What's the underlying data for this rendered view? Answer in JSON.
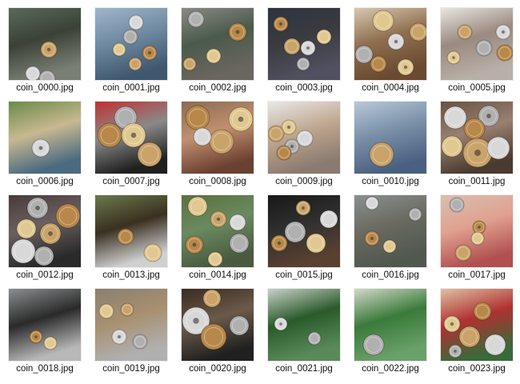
{
  "files": [
    {
      "name": "coin_0000.jpg",
      "bg": [
        "#5a6a5a",
        "#3b4136",
        "#7a7f74"
      ],
      "coins": [
        [
          50,
          52,
          10
        ],
        [
          30,
          82,
          9
        ],
        [
          48,
          88,
          10
        ]
      ]
    },
    {
      "name": "coin_0001.jpg",
      "bg": [
        "#9fb6cc",
        "#6f8aa1",
        "#3f5870"
      ],
      "coins": [
        [
          51,
          18,
          9
        ],
        [
          44,
          36,
          9
        ],
        [
          68,
          56,
          9
        ],
        [
          30,
          52,
          8
        ],
        [
          50,
          70,
          8
        ]
      ]
    },
    {
      "name": "coin_0002.jpg",
      "bg": [
        "#8a8a86",
        "#4a5a4a",
        "#6a6660"
      ],
      "coins": [
        [
          18,
          14,
          10
        ],
        [
          70,
          30,
          11
        ],
        [
          40,
          60,
          9
        ],
        [
          10,
          70,
          8
        ]
      ]
    },
    {
      "name": "coin_0003.jpg",
      "bg": [
        "#2e3440",
        "#3a3b3f",
        "#505060"
      ],
      "coins": [
        [
          16,
          20,
          9
        ],
        [
          70,
          36,
          9
        ],
        [
          30,
          48,
          10
        ],
        [
          50,
          50,
          9
        ],
        [
          44,
          70,
          8
        ]
      ]
    },
    {
      "name": "coin_0004.jpg",
      "bg": [
        "#d8c8b0",
        "#8f6f4f",
        "#6a4a30"
      ],
      "coins": [
        [
          36,
          16,
          13
        ],
        [
          80,
          30,
          11
        ],
        [
          52,
          42,
          10
        ],
        [
          12,
          58,
          11
        ],
        [
          30,
          70,
          10
        ],
        [
          64,
          74,
          10
        ]
      ]
    },
    {
      "name": "coin_0005.jpg",
      "bg": [
        "#e8e6e0",
        "#9a8a80",
        "#b8b0a8"
      ],
      "coins": [
        [
          30,
          30,
          9
        ],
        [
          78,
          30,
          9
        ],
        [
          54,
          50,
          10
        ],
        [
          80,
          56,
          10
        ],
        [
          16,
          62,
          8
        ]
      ]
    },
    {
      "name": "coin_0006.jpg",
      "bg": [
        "#6a8a4a",
        "#c8b890",
        "#4a6a80"
      ],
      "coins": [
        [
          40,
          58,
          11
        ]
      ]
    },
    {
      "name": "coin_0007.jpg",
      "bg": [
        "#c03030",
        "#8a8a8a",
        "#202020"
      ],
      "coins": [
        [
          38,
          20,
          14
        ],
        [
          18,
          42,
          15
        ],
        [
          48,
          42,
          15
        ],
        [
          68,
          66,
          15
        ]
      ]
    },
    {
      "name": "coin_0008.jpg",
      "bg": [
        "#8a6a50",
        "#c09070",
        "#6a4030"
      ],
      "coins": [
        [
          20,
          20,
          15
        ],
        [
          74,
          22,
          15
        ],
        [
          50,
          50,
          15
        ],
        [
          26,
          44,
          11
        ]
      ]
    },
    {
      "name": "coin_0009.jpg",
      "bg": [
        "#e8e8e8",
        "#c0a890",
        "#8a7a70"
      ],
      "coins": [
        [
          26,
          32,
          9
        ],
        [
          10,
          40,
          10
        ],
        [
          46,
          46,
          10
        ],
        [
          30,
          56,
          9
        ],
        [
          20,
          64,
          9
        ]
      ]
    },
    {
      "name": "coin_0010.jpg",
      "bg": [
        "#b8c8d8",
        "#7a90a8",
        "#4a6080"
      ],
      "coins": [
        [
          34,
          66,
          15
        ]
      ]
    },
    {
      "name": "coin_0011.jpg",
      "bg": [
        "#6a5040",
        "#9a8070",
        "#4a3a30"
      ],
      "coins": [
        [
          18,
          20,
          14
        ],
        [
          60,
          18,
          13
        ],
        [
          42,
          34,
          13
        ],
        [
          14,
          56,
          13
        ],
        [
          46,
          64,
          18
        ],
        [
          72,
          58,
          14
        ]
      ]
    },
    {
      "name": "coin_0012.jpg",
      "bg": [
        "#4a3a3a",
        "#6a6060",
        "#2a2a2a"
      ],
      "coins": [
        [
          36,
          16,
          13
        ],
        [
          74,
          26,
          15
        ],
        [
          22,
          42,
          12
        ],
        [
          52,
          48,
          13
        ],
        [
          18,
          70,
          15
        ],
        [
          44,
          76,
          12
        ]
      ]
    },
    {
      "name": "coin_0013.jpg",
      "bg": [
        "#6a7a4a",
        "#3a3020",
        "#d0d0d0"
      ],
      "coins": [
        [
          38,
          52,
          10
        ],
        [
          72,
          72,
          11
        ]
      ]
    },
    {
      "name": "coin_0014.jpg",
      "bg": [
        "#5a7040",
        "#6a8a60",
        "#4a5a40"
      ],
      "coins": [
        [
          20,
          14,
          12
        ],
        [
          46,
          30,
          10
        ],
        [
          70,
          34,
          10
        ],
        [
          72,
          60,
          12
        ],
        [
          16,
          62,
          11
        ],
        [
          42,
          80,
          9
        ]
      ]
    },
    {
      "name": "coin_0015.jpg",
      "bg": [
        "#181818",
        "#303030",
        "#5a4030"
      ],
      "coins": [
        [
          44,
          16,
          9
        ],
        [
          76,
          30,
          11
        ],
        [
          34,
          46,
          13
        ],
        [
          14,
          60,
          10
        ],
        [
          60,
          60,
          12
        ]
      ]
    },
    {
      "name": "coin_0016.jpg",
      "bg": [
        "#8a9090",
        "#6a6a60",
        "#505850"
      ],
      "coins": [
        [
          22,
          10,
          8
        ],
        [
          76,
          24,
          8
        ],
        [
          22,
          54,
          9
        ],
        [
          44,
          64,
          8
        ]
      ]
    },
    {
      "name": "coin_0017.jpg",
      "bg": [
        "#d8c0b0",
        "#e0a090",
        "#b05050"
      ],
      "coins": [
        [
          20,
          12,
          9
        ],
        [
          48,
          40,
          8
        ],
        [
          46,
          54,
          8
        ],
        [
          28,
          72,
          10
        ]
      ]
    },
    {
      "name": "coin_0018.jpg",
      "bg": [
        "#8a8f90",
        "#2a2a2a",
        "#b8b8b8"
      ],
      "coins": [
        [
          34,
          60,
          8
        ],
        [
          52,
          68,
          8
        ]
      ]
    },
    {
      "name": "coin_0019.jpg",
      "bg": [
        "#8a8070",
        "#a89070",
        "#b0b0b0"
      ],
      "coins": [
        [
          14,
          28,
          9
        ],
        [
          40,
          26,
          8
        ],
        [
          30,
          60,
          9
        ],
        [
          56,
          66,
          9
        ]
      ]
    },
    {
      "name": "coin_0020.jpg",
      "bg": [
        "#3a2a20",
        "#6a5a4a",
        "#202020"
      ],
      "coins": [
        [
          38,
          12,
          11
        ],
        [
          18,
          40,
          17
        ],
        [
          72,
          46,
          12
        ],
        [
          40,
          60,
          16
        ]
      ]
    },
    {
      "name": "coin_0021.jpg",
      "bg": [
        "#c8d0c8",
        "#2a5a2a",
        "#5a8a5a"
      ],
      "coins": [
        [
          16,
          44,
          8
        ],
        [
          58,
          62,
          8
        ]
      ]
    },
    {
      "name": "coin_0022.jpg",
      "bg": [
        "#d0d8c8",
        "#3a7a3a",
        "#6aa06a"
      ],
      "coins": [
        [
          24,
          70,
          13
        ]
      ]
    },
    {
      "name": "coin_0023.jpg",
      "bg": [
        "#e0c0a0",
        "#b03030",
        "#3a6a3a"
      ],
      "coins": [
        [
          52,
          28,
          11
        ],
        [
          14,
          44,
          10
        ],
        [
          36,
          60,
          13
        ],
        [
          68,
          70,
          13
        ],
        [
          18,
          78,
          8
        ]
      ]
    }
  ],
  "coin_colors": [
    "#c9a36a",
    "#d8d8d8",
    "#b0b0b0",
    "#b8884a",
    "#e0c890"
  ]
}
